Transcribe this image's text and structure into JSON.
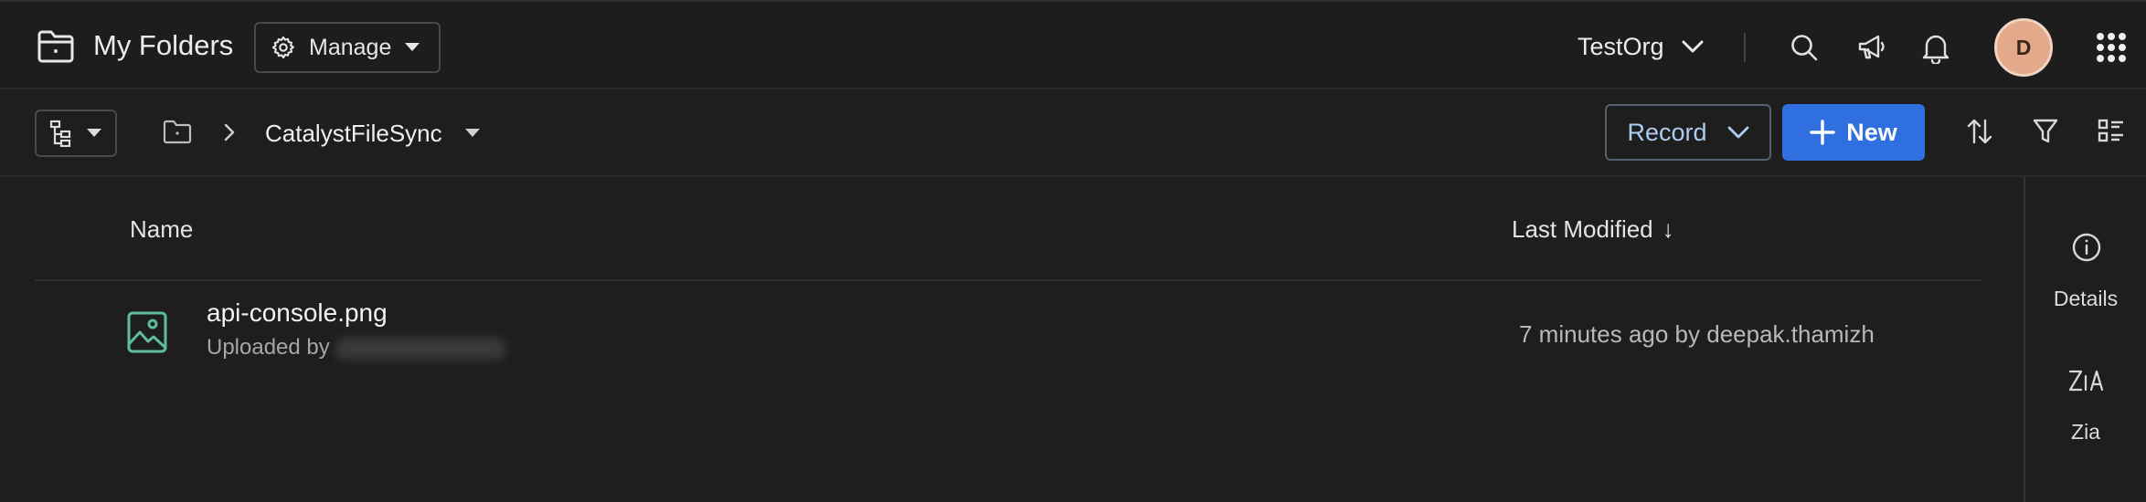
{
  "header": {
    "title": "My Folders",
    "manage_label": "Manage",
    "org_name": "TestOrg",
    "avatar_initial": "D",
    "icons": [
      "folder-icon",
      "gear-icon",
      "search-icon",
      "announcement-icon",
      "bell-icon",
      "apps-grid-icon"
    ]
  },
  "toolbar": {
    "breadcrumb_folder": "CatalystFileSync",
    "record_label": "Record",
    "new_label": "New"
  },
  "table": {
    "columns": [
      "Name",
      "Last Modified"
    ],
    "sort_indicator": "↓",
    "rows": [
      {
        "name": "api-console.png",
        "uploaded_prefix": "Uploaded by",
        "modified": "7 minutes ago by deepak.thamizh",
        "icon": "image-file-icon"
      }
    ]
  },
  "side_panel": {
    "items": [
      {
        "label": "Details",
        "icon": "info-icon"
      },
      {
        "label": "Zia",
        "icon": "zia-icon"
      }
    ]
  },
  "colors": {
    "background": "#1e1e1e",
    "primary_button": "#2f6fe0",
    "record_text": "#aecbf0",
    "file_icon": "#5dbf9a",
    "avatar": "#e2a98a"
  }
}
